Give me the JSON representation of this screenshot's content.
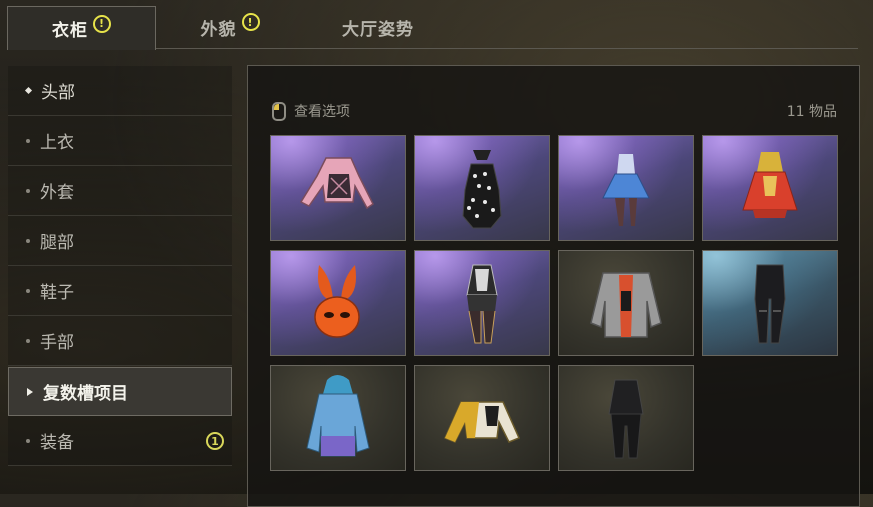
{
  "tabs": [
    {
      "label": "衣柜",
      "alert": "!"
    },
    {
      "label": "外貌",
      "alert": "!"
    },
    {
      "label": "大厅姿势"
    }
  ],
  "sidebar": {
    "items": [
      {
        "label": "头部"
      },
      {
        "label": "上衣"
      },
      {
        "label": "外套"
      },
      {
        "label": "腿部"
      },
      {
        "label": "鞋子"
      },
      {
        "label": "手部"
      },
      {
        "label": "复数槽项目"
      },
      {
        "label": "装备",
        "badge": "1"
      }
    ]
  },
  "panel": {
    "view_options": "查看选项",
    "item_count": "11 物品",
    "items": [
      {
        "icon": "pink-cropped-jacket-icon",
        "rarity_color": "#7a67b6"
      },
      {
        "icon": "polka-dot-swimsuit-icon",
        "rarity_color": "#7a67b6"
      },
      {
        "icon": "blue-dress-outfit-icon",
        "rarity_color": "#7a67b6"
      },
      {
        "icon": "red-dress-outfit-icon",
        "rarity_color": "#7a67b6"
      },
      {
        "icon": "bunny-mask-icon",
        "rarity_color": "#7a67b6"
      },
      {
        "icon": "rider-suit-icon",
        "rarity_color": "#7a67b6"
      },
      {
        "icon": "gray-jacket-icon",
        "rarity_color": "#4a4739"
      },
      {
        "icon": "black-pants-icon",
        "rarity_color": "#5f8ea5"
      },
      {
        "icon": "blue-hoodie-icon",
        "rarity_color": "#4a4739"
      },
      {
        "icon": "yellow-white-jacket-icon",
        "rarity_color": "#4a4739"
      },
      {
        "icon": "black-suit-icon",
        "rarity_color": "#4a4739"
      }
    ]
  }
}
